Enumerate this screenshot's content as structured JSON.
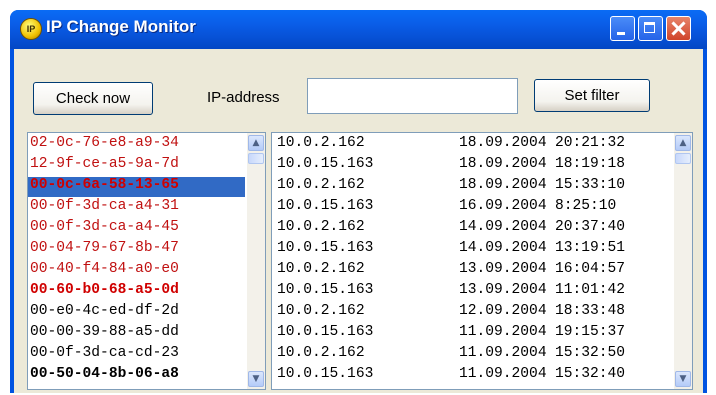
{
  "window": {
    "title": "IP Change Monitor",
    "icon": "ip-app-icon",
    "icon_text": "IP"
  },
  "toolbar": {
    "check_label": "Check now",
    "ip_label": "IP-address",
    "ip_value": "",
    "filter_label": "Set filter"
  },
  "mac_list": [
    {
      "text": "02-0c-76-e8-a9-34",
      "color": "#c01010",
      "bold": false,
      "selected": false
    },
    {
      "text": "12-9f-ce-a5-9a-7d",
      "color": "#c01010",
      "bold": false,
      "selected": false
    },
    {
      "text": "00-0c-6a-58-13-65",
      "color": "#d00000",
      "bold": true,
      "selected": true
    },
    {
      "text": "00-0f-3d-ca-a4-31",
      "color": "#c01010",
      "bold": false,
      "selected": false
    },
    {
      "text": "00-0f-3d-ca-a4-45",
      "color": "#c01010",
      "bold": false,
      "selected": false
    },
    {
      "text": "00-04-79-67-8b-47",
      "color": "#c01010",
      "bold": false,
      "selected": false
    },
    {
      "text": "00-40-f4-84-a0-e0",
      "color": "#c01010",
      "bold": false,
      "selected": false
    },
    {
      "text": "00-60-b0-68-a5-0d",
      "color": "#d00000",
      "bold": true,
      "selected": false
    },
    {
      "text": "00-e0-4c-ed-df-2d",
      "color": "#000000",
      "bold": false,
      "selected": false
    },
    {
      "text": "00-00-39-88-a5-dd",
      "color": "#000000",
      "bold": false,
      "selected": false
    },
    {
      "text": "00-0f-3d-ca-cd-23",
      "color": "#000000",
      "bold": false,
      "selected": false
    },
    {
      "text": "00-50-04-8b-06-a8",
      "color": "#000000",
      "bold": true,
      "selected": false
    }
  ],
  "log": [
    {
      "ip": "10.0.2.162",
      "date": "18.09.2004",
      "time": "20:21:32"
    },
    {
      "ip": "10.0.15.163",
      "date": "18.09.2004",
      "time": "18:19:18"
    },
    {
      "ip": "10.0.2.162",
      "date": "18.09.2004",
      "time": "15:33:10"
    },
    {
      "ip": "10.0.15.163",
      "date": "16.09.2004",
      "time": "8:25:10"
    },
    {
      "ip": "10.0.2.162",
      "date": "14.09.2004",
      "time": "20:37:40"
    },
    {
      "ip": "10.0.15.163",
      "date": "14.09.2004",
      "time": "13:19:51"
    },
    {
      "ip": "10.0.2.162",
      "date": "13.09.2004",
      "time": "16:04:57"
    },
    {
      "ip": "10.0.15.163",
      "date": "13.09.2004",
      "time": "11:01:42"
    },
    {
      "ip": "10.0.2.162",
      "date": "12.09.2004",
      "time": "18:33:48"
    },
    {
      "ip": "10.0.15.163",
      "date": "11.09.2004",
      "time": "19:15:37"
    },
    {
      "ip": "10.0.2.162",
      "date": "11.09.2004",
      "time": "15:32:50"
    },
    {
      "ip": "10.0.15.163",
      "date": "11.09.2004",
      "time": "15:32:40"
    }
  ],
  "colors": {
    "selected_bg": "#316ac5",
    "selected_text": "#d00000"
  },
  "icons": {
    "scroll_up": "scroll-up-arrow-icon",
    "scroll_down": "scroll-down-arrow-icon"
  }
}
